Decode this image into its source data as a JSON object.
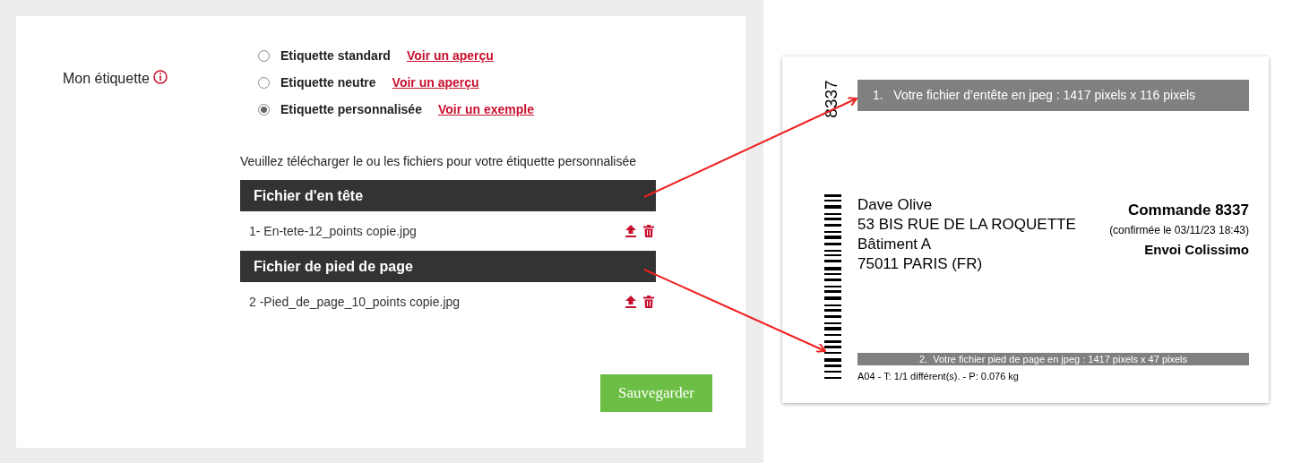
{
  "settings": {
    "label": "Mon étiquette",
    "options": [
      {
        "label": "Etiquette standard",
        "link": "Voir un aperçu",
        "selected": false
      },
      {
        "label": "Etiquette neutre",
        "link": "Voir un aperçu",
        "selected": false
      },
      {
        "label": "Etiquette personnalisée",
        "link": "Voir un exemple",
        "selected": true
      }
    ],
    "instruction": "Veuillez télécharger le ou les fichiers pour votre étiquette personnalisée",
    "files": [
      {
        "heading": "Fichier d'en tête",
        "file": "1- En-tete-12_points copie.jpg"
      },
      {
        "heading": "Fichier de pied de page",
        "file": "2 -Pied_de_page_10_points copie.jpg"
      }
    ],
    "save_button": "Sauvegarder"
  },
  "label_preview": {
    "side_number": "8337",
    "header_bar": "1.   Votre fichier d’entête en jpeg : 1417 pixels x 116 pixels",
    "address": [
      "Dave Olive",
      "53 BIS RUE DE LA ROQUETTE",
      "Bâtiment A",
      "75011 PARIS (FR)"
    ],
    "order": "Commande 8337",
    "confirmed": "(confirmée le 03/11/23 18:43)",
    "shipping": "Envoi Colissimo",
    "footer_bar": "2.  Votre fichier pied de page en jpeg : 1417 pixels x 47 pixels",
    "details": "A04 - T: 1/1 différent(s). - P: 0.076 kg"
  }
}
